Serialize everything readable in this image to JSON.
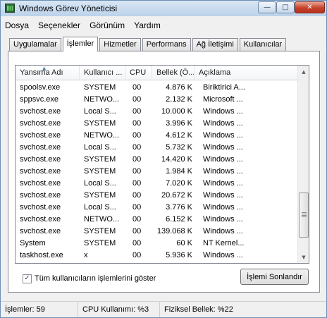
{
  "window": {
    "title": "Windows Görev Yöneticisi",
    "controls": {
      "minimize": "—",
      "maximize": "□",
      "close": "✕"
    }
  },
  "menu": [
    "Dosya",
    "Seçenekler",
    "Görünüm",
    "Yardım"
  ],
  "tabs": [
    {
      "label": "Uygulamalar",
      "active": false
    },
    {
      "label": "İşlemler",
      "active": true
    },
    {
      "label": "Hizmetler",
      "active": false
    },
    {
      "label": "Performans",
      "active": false
    },
    {
      "label": "Ağ İletişimi",
      "active": false
    },
    {
      "label": "Kullanıcılar",
      "active": false
    }
  ],
  "table": {
    "columns": [
      "Yansıma Adı",
      "Kullanıcı ...",
      "CPU",
      "Bellek (Ö...",
      "Açıklama"
    ],
    "sorted_column": "Yansıma Adı",
    "rows": [
      {
        "name": "spoolsv.exe",
        "user": "SYSTEM",
        "cpu": "00",
        "mem": "4.876 K",
        "desc": "Biriktirici A..."
      },
      {
        "name": "sppsvc.exe",
        "user": "NETWO...",
        "cpu": "00",
        "mem": "2.132 K",
        "desc": "Microsoft ..."
      },
      {
        "name": "svchost.exe",
        "user": "Local S...",
        "cpu": "00",
        "mem": "10.000 K",
        "desc": "Windows ..."
      },
      {
        "name": "svchost.exe",
        "user": "SYSTEM",
        "cpu": "00",
        "mem": "3.996 K",
        "desc": "Windows ..."
      },
      {
        "name": "svchost.exe",
        "user": "NETWO...",
        "cpu": "00",
        "mem": "4.612 K",
        "desc": "Windows ..."
      },
      {
        "name": "svchost.exe",
        "user": "Local S...",
        "cpu": "00",
        "mem": "5.732 K",
        "desc": "Windows ..."
      },
      {
        "name": "svchost.exe",
        "user": "SYSTEM",
        "cpu": "00",
        "mem": "14.420 K",
        "desc": "Windows ..."
      },
      {
        "name": "svchost.exe",
        "user": "SYSTEM",
        "cpu": "00",
        "mem": "1.984 K",
        "desc": "Windows ..."
      },
      {
        "name": "svchost.exe",
        "user": "Local S...",
        "cpu": "00",
        "mem": "7.020 K",
        "desc": "Windows ..."
      },
      {
        "name": "svchost.exe",
        "user": "SYSTEM",
        "cpu": "00",
        "mem": "20.672 K",
        "desc": "Windows ..."
      },
      {
        "name": "svchost.exe",
        "user": "Local S...",
        "cpu": "00",
        "mem": "3.776 K",
        "desc": "Windows ..."
      },
      {
        "name": "svchost.exe",
        "user": "NETWO...",
        "cpu": "00",
        "mem": "6.152 K",
        "desc": "Windows ..."
      },
      {
        "name": "svchost.exe",
        "user": "SYSTEM",
        "cpu": "00",
        "mem": "139.068 K",
        "desc": "Windows ..."
      },
      {
        "name": "System",
        "user": "SYSTEM",
        "cpu": "00",
        "mem": "60 K",
        "desc": "NT Kernel..."
      },
      {
        "name": "taskhost.exe",
        "user": "x",
        "cpu": "00",
        "mem": "5.936 K",
        "desc": "Windows ..."
      }
    ]
  },
  "show_all_users": {
    "label": "Tüm kullanıcıların işlemlerini göster",
    "checked": true,
    "mark": "✓"
  },
  "end_process_button": "İşlemi Sonlandır",
  "status": {
    "processes": "İşlemler: 59",
    "cpu": "CPU Kullanımı: %3",
    "memory": "Fiziksel Bellek: %22"
  },
  "icons": {
    "app": "task-manager-icon",
    "sort": "sort-ascending-icon",
    "scroll_up": "scroll-up-arrow-icon",
    "scroll_down": "scroll-down-arrow-icon"
  }
}
